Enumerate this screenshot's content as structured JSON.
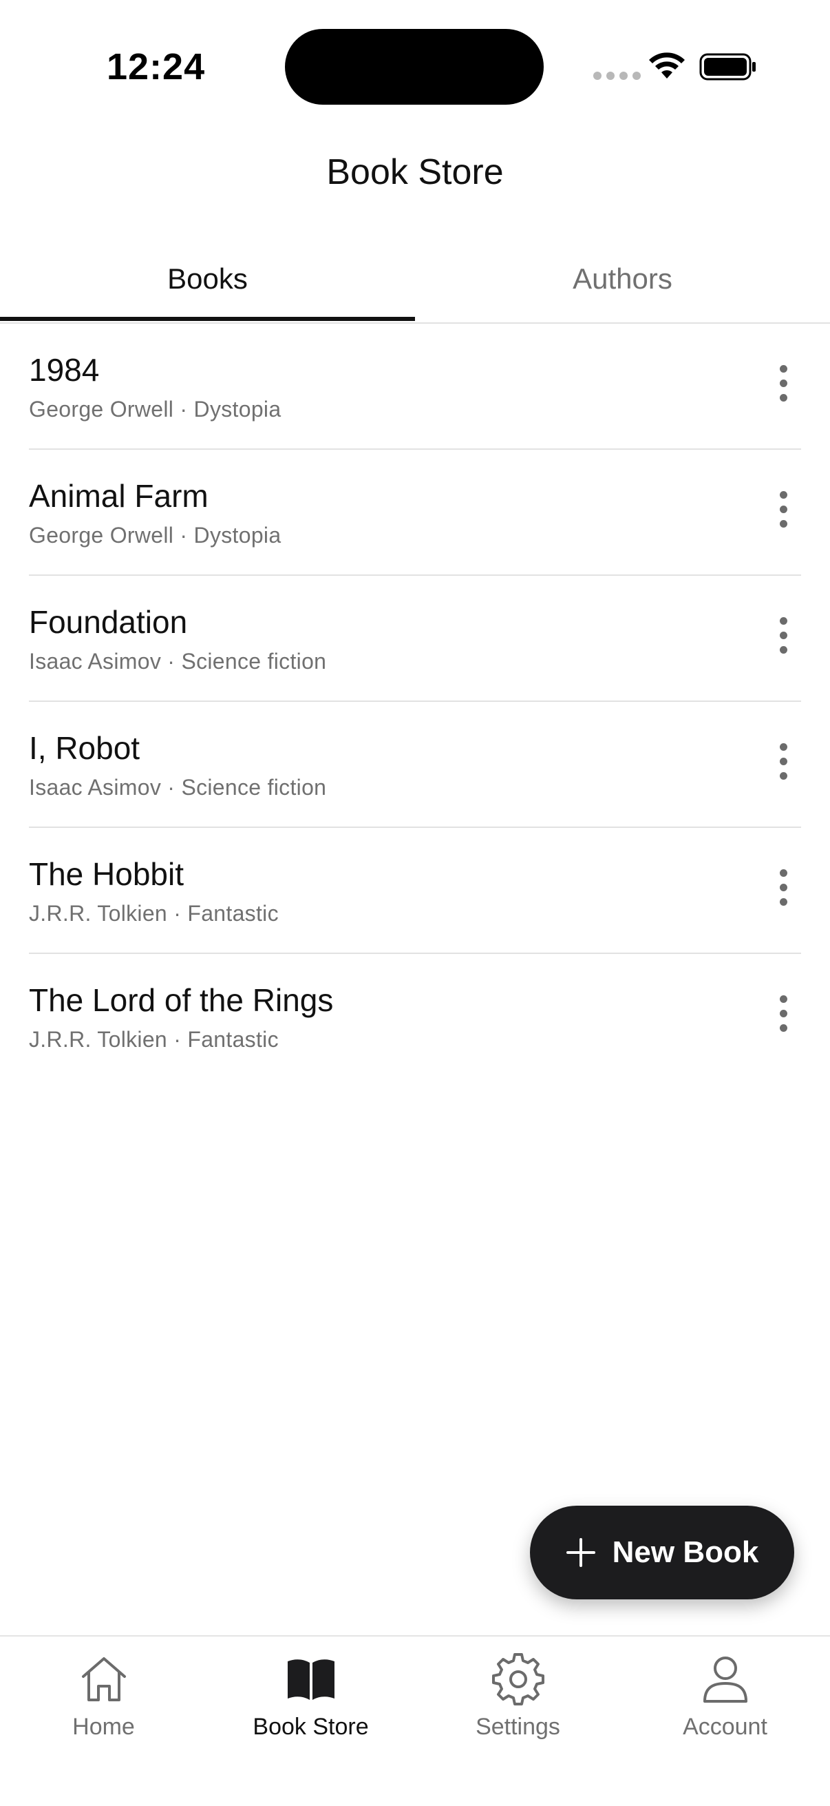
{
  "status_bar": {
    "time": "12:24"
  },
  "header": {
    "title": "Book Store"
  },
  "tabs": [
    {
      "label": "Books",
      "active": true
    },
    {
      "label": "Authors",
      "active": false
    }
  ],
  "books": [
    {
      "title": "1984",
      "meta": "George Orwell · Dystopia"
    },
    {
      "title": "Animal Farm",
      "meta": "George Orwell · Dystopia"
    },
    {
      "title": "Foundation",
      "meta": "Isaac Asimov · Science fiction"
    },
    {
      "title": "I, Robot",
      "meta": "Isaac Asimov · Science fiction"
    },
    {
      "title": "The Hobbit",
      "meta": "J.R.R. Tolkien · Fantastic"
    },
    {
      "title": "The Lord of the Rings",
      "meta": "J.R.R. Tolkien · Fantastic"
    }
  ],
  "fab": {
    "label": "New Book",
    "icon": "plus-icon"
  },
  "bottom_nav": [
    {
      "label": "Home",
      "icon": "home-icon",
      "active": false
    },
    {
      "label": "Book Store",
      "icon": "book-icon",
      "active": true
    },
    {
      "label": "Settings",
      "icon": "gear-icon",
      "active": false
    },
    {
      "label": "Account",
      "icon": "person-icon",
      "active": false
    }
  ],
  "colors": {
    "primary_text": "#111111",
    "secondary_text": "#707070",
    "fab_background": "#1c1c1e",
    "divider": "#e2e2e2"
  }
}
